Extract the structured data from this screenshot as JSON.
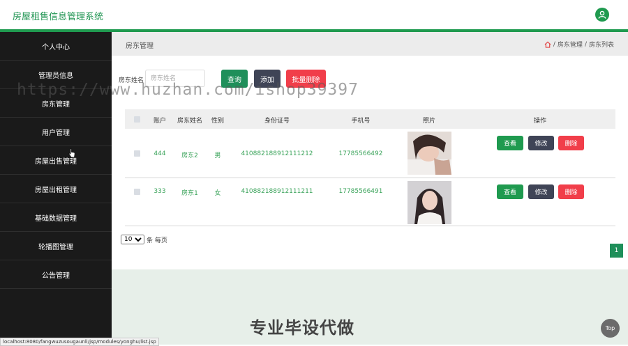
{
  "app": {
    "title": "房屋租售信息管理系统"
  },
  "sidebar": {
    "items": [
      {
        "label": "个人中心"
      },
      {
        "label": "管理员信息"
      },
      {
        "label": "房东管理"
      },
      {
        "label": "用户管理"
      },
      {
        "label": "房屋出售管理"
      },
      {
        "label": "房屋出租管理"
      },
      {
        "label": "基础数据管理"
      },
      {
        "label": "轮播图管理"
      },
      {
        "label": "公告管理"
      }
    ]
  },
  "breadcrumb": {
    "title": "房东管理",
    "path1": "房东管理",
    "sep": "/",
    "path2": "房东列表"
  },
  "search": {
    "label": "房东姓名",
    "placeholder": "房东姓名",
    "value": ""
  },
  "toolbar": {
    "query_label": "查询",
    "add_label": "添加",
    "batch_delete_label": "批量删除"
  },
  "table": {
    "columns": [
      "账户",
      "房东姓名",
      "性别",
      "身份证号",
      "手机号",
      "照片",
      "操作"
    ],
    "rows": [
      {
        "account": "444",
        "name": "房东2",
        "gender": "男",
        "id_number": "410882188912111212",
        "phone": "17785566492"
      },
      {
        "account": "333",
        "name": "房东1",
        "gender": "女",
        "id_number": "410882188912111211",
        "phone": "17785566491"
      }
    ],
    "actions": {
      "view": "查看",
      "edit": "修改",
      "delete": "删除"
    }
  },
  "pagination": {
    "page_size": "10",
    "per_page_label": "条 每页",
    "current_page": "1"
  },
  "footer": {
    "promo_text": "专业毕设代做",
    "top_label": "Top",
    "status_url": "localhost:8080/fangwuzusougaunli/jsp/modules/yonghu/list.jsp"
  },
  "watermark": {
    "text": "https://www.huzhan.com/ishop39397"
  },
  "colors": {
    "accent": "#1f9a4f",
    "sidebar_bg": "#1a1a1a",
    "danger": "#f13e4a",
    "secondary": "#3f4456"
  }
}
